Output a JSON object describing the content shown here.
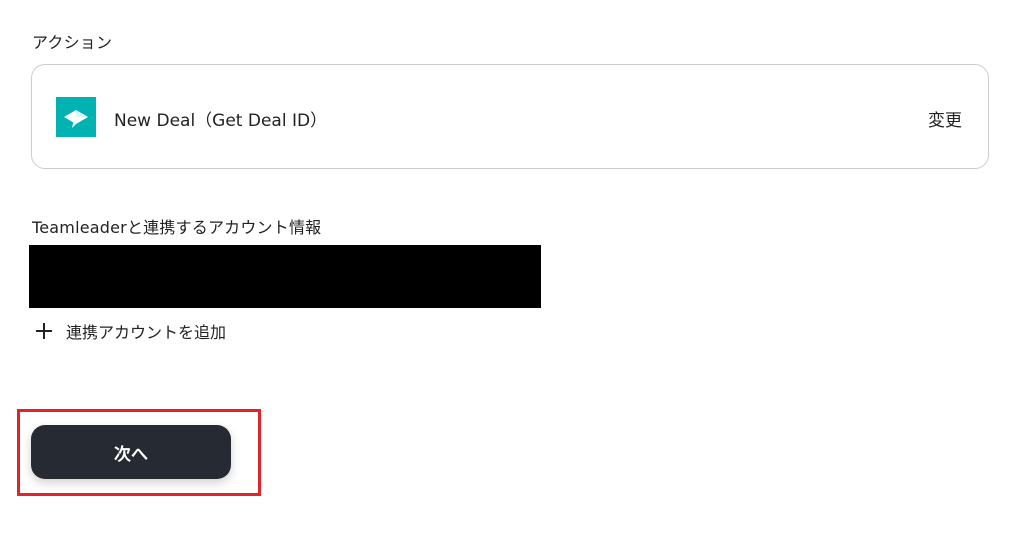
{
  "action_section": {
    "label": "アクション",
    "action_name": "New Deal（Get Deal ID）",
    "change_label": "変更",
    "app_icon": "teamleader-logo-icon",
    "app_color": "#00b2b2"
  },
  "account_section": {
    "label": "Teamleaderと連携するアカウント情報",
    "add_account_label": "連携アカウントを追加",
    "add_icon": "plus-icon"
  },
  "footer": {
    "next_label": "次へ",
    "next_button_color": "#262a33",
    "highlight_color": "#e0242c"
  }
}
